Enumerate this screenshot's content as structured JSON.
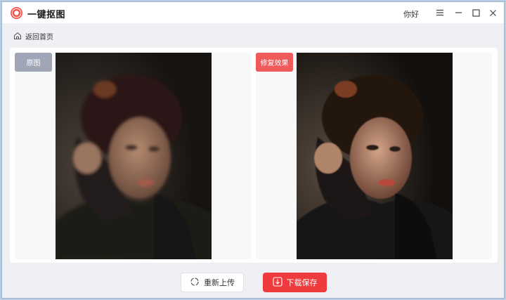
{
  "app": {
    "title": "一键抠图",
    "user_name": "你好"
  },
  "window_controls": [
    "menu-icon",
    "minimize-icon",
    "maximize-icon",
    "close-icon"
  ],
  "nav": {
    "back_label": "返回首页"
  },
  "panels": {
    "original_label": "原图",
    "result_label": "修复效果"
  },
  "actions": {
    "reupload_label": "重新上传",
    "download_label": "下载保存"
  },
  "colors": {
    "accent": "#ef3b3d",
    "result_tag": "#ef5a5a",
    "original_tag": "#a0a6b6"
  }
}
